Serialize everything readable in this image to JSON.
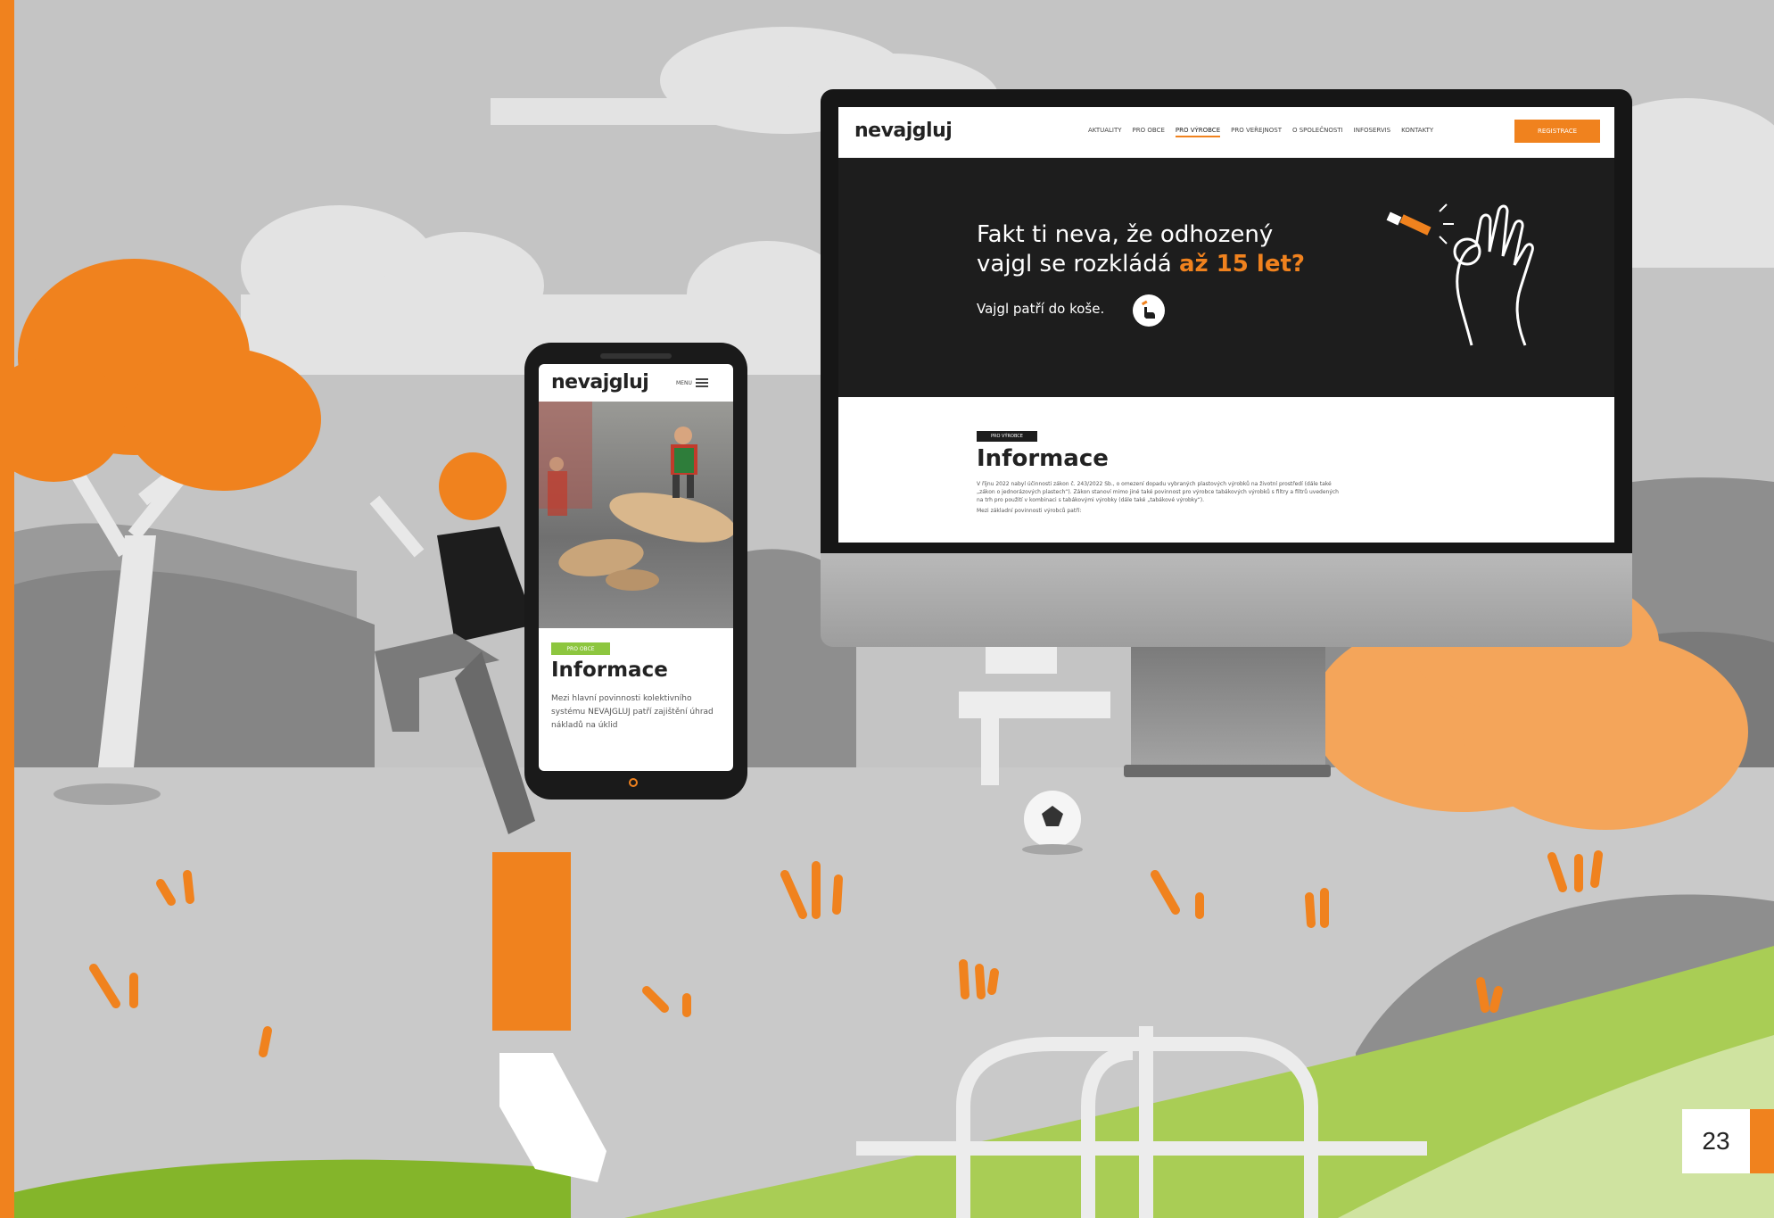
{
  "desktop_site": {
    "logo": "nevajgluj",
    "nav": [
      "AKTUALITY",
      "PRO OBCE",
      "PRO VÝROBCE",
      "PRO VEŘEJNOST",
      "O SPOLEČNOSTI",
      "INFOSERVIS",
      "KONTAKTY"
    ],
    "cta_label": "REGISTRACE",
    "hero": {
      "title_line1": "Fakt ti neva, že odhozený",
      "title_line2_prefix": "vajgl se rozkládá ",
      "title_highlight": "až 15 let?",
      "subtitle": "Vajgl patří do koše."
    },
    "content": {
      "tag": "PRO VÝROBCE",
      "title": "Informace",
      "paragraph": "V říjnu 2022 nabyl účinnosti zákon č. 243/2022 Sb., o omezení dopadu vybraných plastových výrobků na životní prostředí (dále také „zákon o jednorázových plastech“). Zákon stanoví mimo jiné také povinnost pro výrobce tabákových výrobků s filtry a filtrů uvedených na trh pro použití v kombinaci s tabákovými výrobky (dále také „tabákové výrobky“).",
      "paragraph2": "Mezi základní povinnosti výrobců patří:"
    }
  },
  "mobile_site": {
    "logo": "nevajgluj",
    "menu_label": "MENU",
    "tag": "PRO OBCE",
    "title": "Informace",
    "paragraph": "Mezi hlavní povinnosti kolektivního systému NEVAJGLUJ patří zajištění úhrad nákladů na úklid"
  },
  "page_number": "23",
  "colors": {
    "accent": "#f0821e",
    "green": "#8dc63f",
    "dark": "#1d1d1d"
  }
}
